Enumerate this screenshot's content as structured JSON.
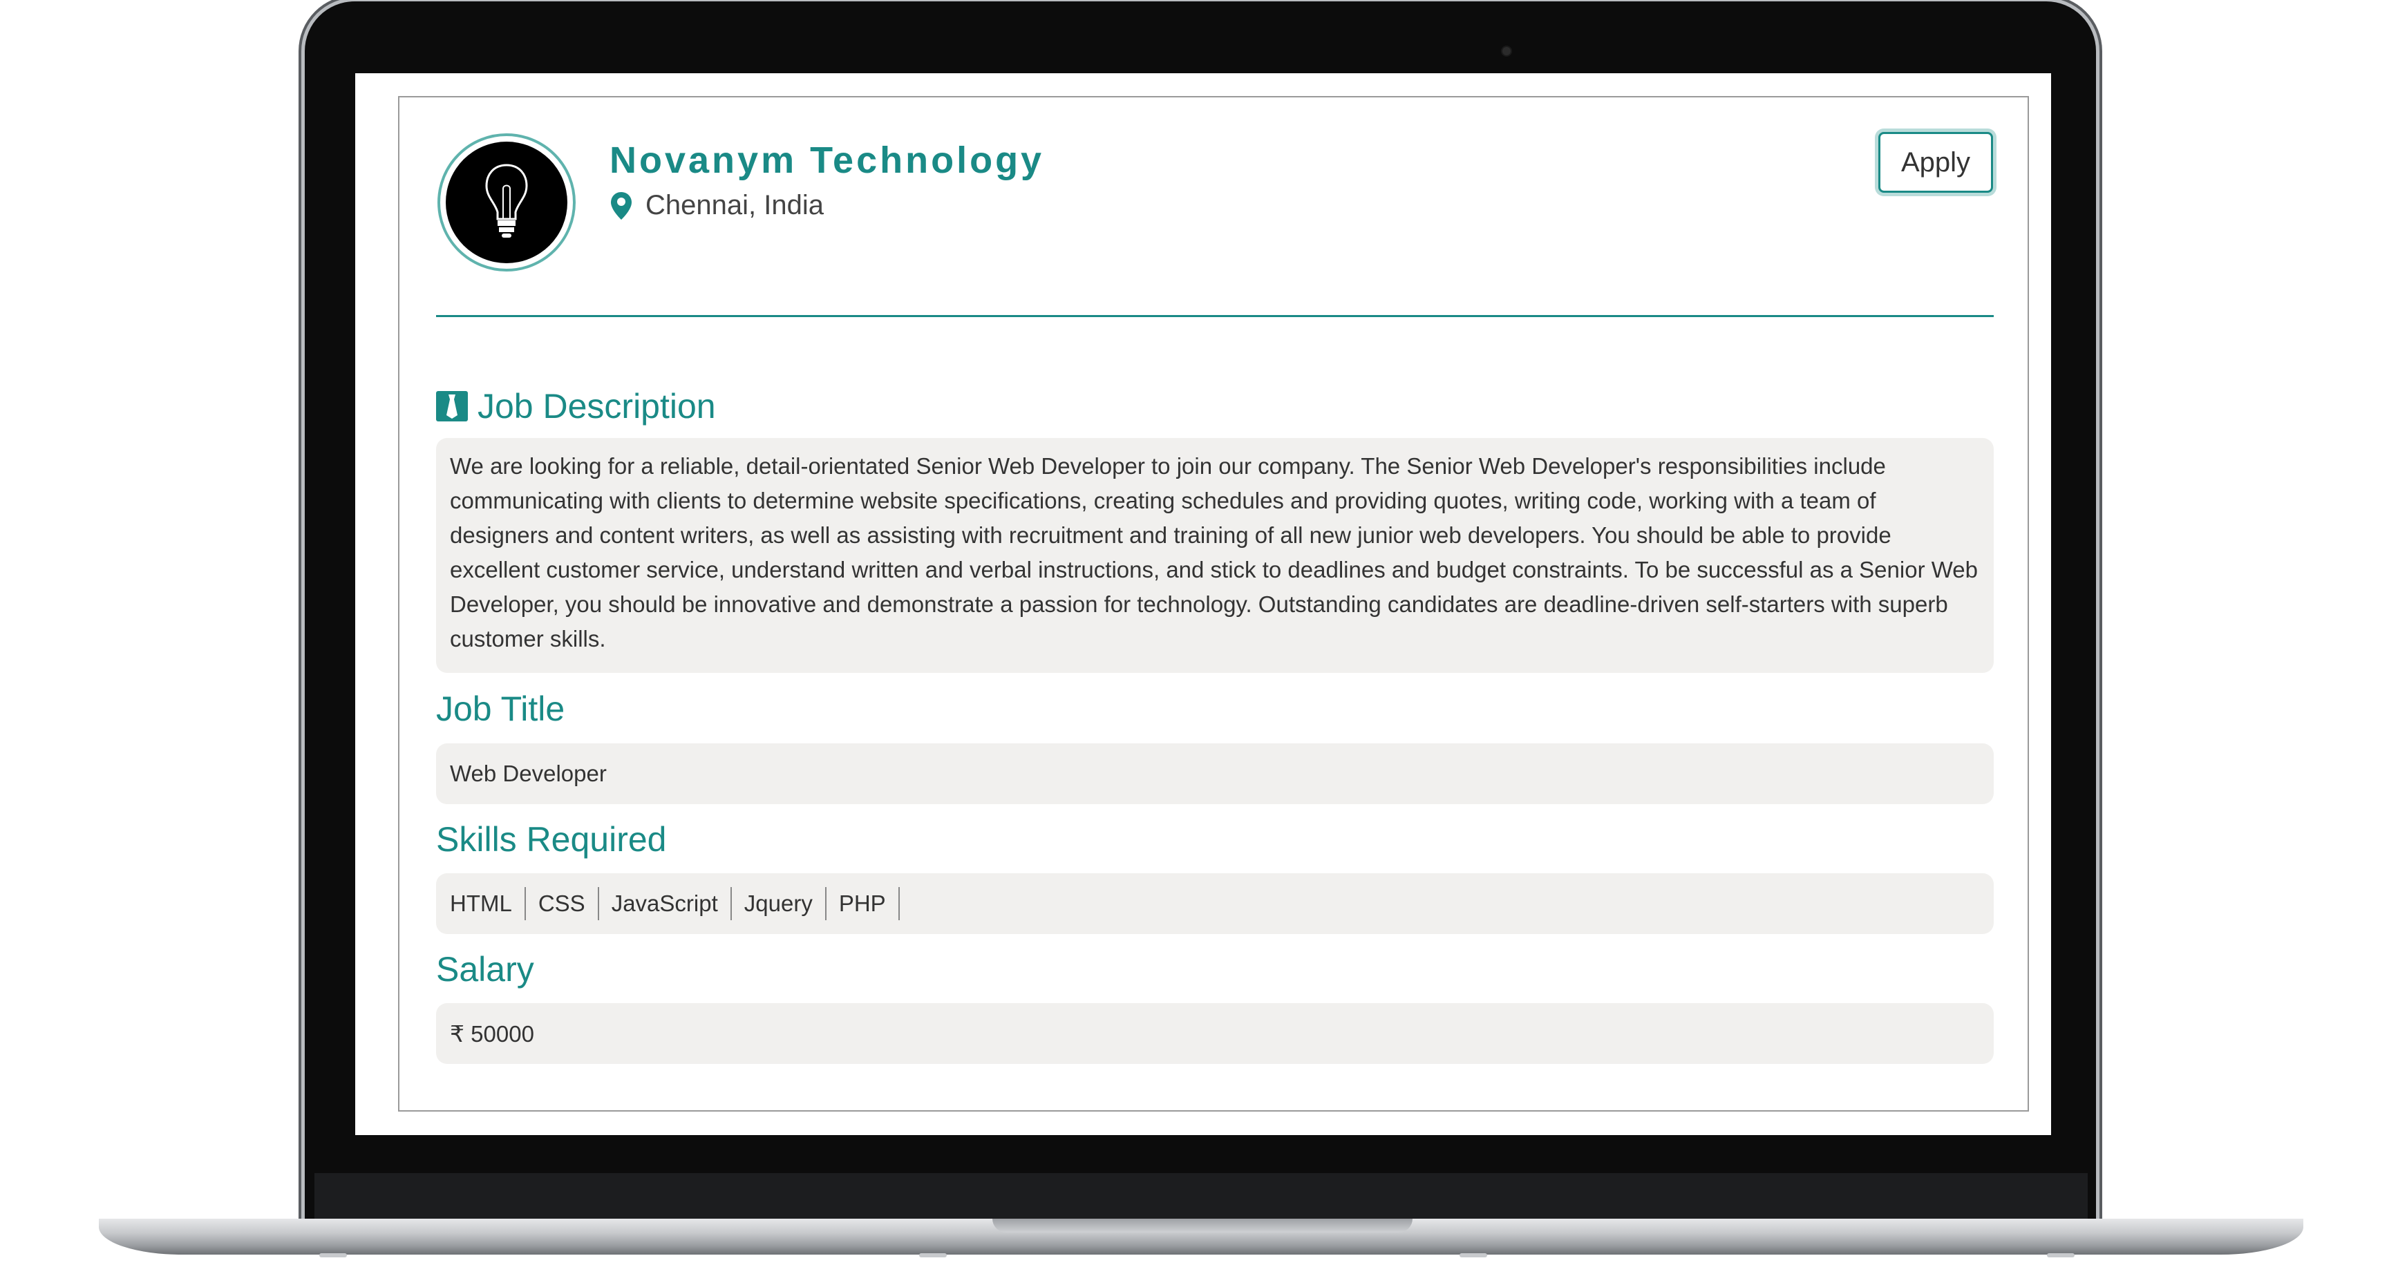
{
  "company": {
    "name": "Novanym Technology",
    "location": "Chennai, India"
  },
  "actions": {
    "apply_label": "Apply"
  },
  "sections": {
    "description": {
      "title": "Job Description",
      "text": "We are looking for a reliable, detail-orientated Senior Web Developer to join our company. The Senior Web Developer's responsibilities include communicating with clients to determine website specifications, creating schedules and providing quotes, writing code, working with a team of designers and content writers, as well as assisting with recruitment and training of all new junior web developers. You should be able to provide excellent customer service, understand written and verbal instructions, and stick to deadlines and budget constraints. To be successful as a Senior Web Developer, you should be innovative and demonstrate a passion for technology. Outstanding candidates are deadline-driven self-starters with superb customer skills."
    },
    "job_title": {
      "title": "Job Title",
      "value": "Web Developer"
    },
    "skills": {
      "title": "Skills Required",
      "items": [
        "HTML",
        "CSS",
        "JavaScript",
        "Jquery",
        "PHP"
      ]
    },
    "salary": {
      "title": "Salary",
      "value": "₹ 50000"
    }
  },
  "icons": {
    "logo": "lightbulb-icon",
    "location": "map-pin-icon",
    "description": "tie-icon"
  },
  "colors": {
    "accent": "#1a8a86",
    "panel_bg": "#f1f0ee",
    "text": "#333333"
  }
}
